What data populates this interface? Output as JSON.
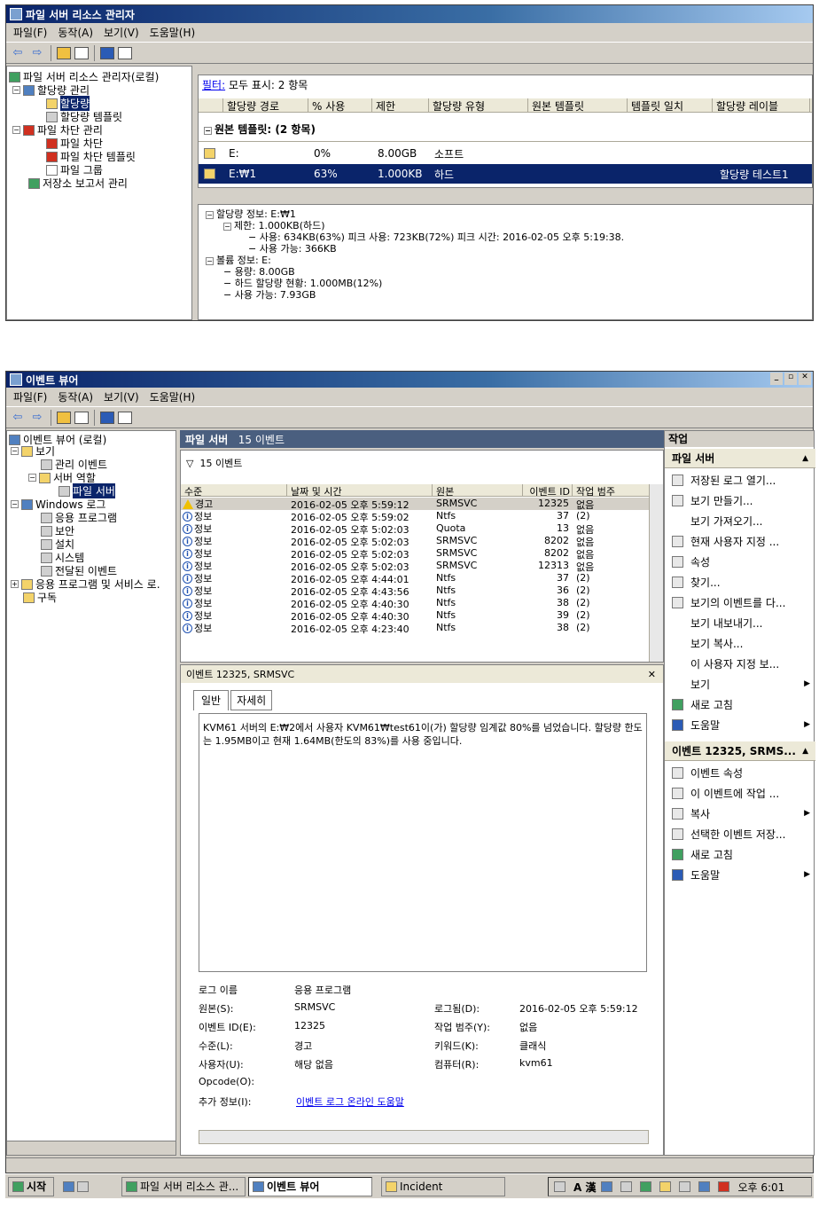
{
  "fsrm": {
    "title": "파일 서버 리소스 관리자",
    "menu": [
      "파일(F)",
      "동작(A)",
      "보기(V)",
      "도움말(H)"
    ],
    "tree": [
      "파일 서버 리소스 관리자(로컬)",
      "할당량 관리",
      "할당량",
      "할당량 템플릿",
      "파일 차단 관리",
      "파일 차단",
      "파일 차단 템플릿",
      "파일 그룹",
      "저장소 보고서 관리"
    ],
    "filter_label": "필터:",
    "filter_text": "모두 표시: 2 항목",
    "columns": [
      "할당량 경로",
      "% 사용",
      "제한",
      "할당량 유형",
      "원본 템플릿",
      "템플릿 일치",
      "할당량 레이블"
    ],
    "group": "원본 템플릿: (2 항목)",
    "rows": [
      {
        "path": "E:",
        "use": "0%",
        "limit": "8.00GB",
        "type": "소프트",
        "label": ""
      },
      {
        "path": "E:₩1",
        "use": "63%",
        "limit": "1.000KB",
        "type": "하드",
        "label": "할당량 테스트1"
      }
    ],
    "details": [
      "할당량 정보: E:₩1",
      "제한: 1.000KB(하드)",
      "사용: 634KB(63%) 피크 사용: 723KB(72%) 피크 시간: 2016-02-05 오후 5:19:38.",
      "사용 가능: 366KB",
      "볼륨 정보: E:",
      "용량: 8.00GB",
      "하드 할당량 현황: 1.000MB(12%)",
      "사용 가능: 7.93GB"
    ]
  },
  "ev": {
    "title": "이벤트 뷰어",
    "menu": [
      "파일(F)",
      "동작(A)",
      "보기(V)",
      "도움말(H)"
    ],
    "tree": [
      "이벤트 뷰어 (로컬)",
      "보기",
      "관리 이벤트",
      "서버 역할",
      "파일 서버",
      "Windows 로그",
      "응용 프로그램",
      "보안",
      "설치",
      "시스템",
      "전달된 이벤트",
      "응용 프로그램 및 서비스 로.",
      "구독"
    ],
    "pane_title": "파일 서버",
    "pane_count": "15 이벤트",
    "filter_text": "15 이벤트",
    "columns": [
      "수준",
      "날짜 및 시간",
      "원본",
      "이벤트 ID",
      "작업 범주"
    ],
    "events": [
      {
        "level": "경고",
        "warn": true,
        "date": "2016-02-05 오후 5:59:12",
        "src": "SRMSVC",
        "id": "12325",
        "cat": "없음"
      },
      {
        "level": "정보",
        "date": "2016-02-05 오후 5:59:02",
        "src": "Ntfs",
        "id": "37",
        "cat": "(2)"
      },
      {
        "level": "정보",
        "date": "2016-02-05 오후 5:02:03",
        "src": "Quota",
        "id": "13",
        "cat": "없음"
      },
      {
        "level": "정보",
        "date": "2016-02-05 오후 5:02:03",
        "src": "SRMSVC",
        "id": "8202",
        "cat": "없음"
      },
      {
        "level": "정보",
        "date": "2016-02-05 오후 5:02:03",
        "src": "SRMSVC",
        "id": "8202",
        "cat": "없음"
      },
      {
        "level": "정보",
        "date": "2016-02-05 오후 5:02:03",
        "src": "SRMSVC",
        "id": "12313",
        "cat": "없음"
      },
      {
        "level": "정보",
        "date": "2016-02-05 오후 4:44:01",
        "src": "Ntfs",
        "id": "37",
        "cat": "(2)"
      },
      {
        "level": "정보",
        "date": "2016-02-05 오후 4:43:56",
        "src": "Ntfs",
        "id": "36",
        "cat": "(2)"
      },
      {
        "level": "정보",
        "date": "2016-02-05 오후 4:40:30",
        "src": "Ntfs",
        "id": "38",
        "cat": "(2)"
      },
      {
        "level": "정보",
        "date": "2016-02-05 오후 4:40:30",
        "src": "Ntfs",
        "id": "39",
        "cat": "(2)"
      },
      {
        "level": "정보",
        "date": "2016-02-05 오후 4:23:40",
        "src": "Ntfs",
        "id": "38",
        "cat": "(2)"
      }
    ],
    "detail_title": "이벤트 12325, SRMSVC",
    "tabs": [
      "일반",
      "자세히"
    ],
    "message": "KVM61 서버의 E:₩2에서 사용자 KVM61₩test61이(가) 할당량 임계값 80%를 넘었습니다. 할당량 한도는 1.95MB이고 현재 1.64MB(한도의 83%)를 사용 중입니다.",
    "fields": {
      "log_name_l": "로그 이름",
      "log_name": "응용 프로그램",
      "source_l": "원본(S):",
      "source": "SRMSVC",
      "logged_l": "로그됨(D):",
      "logged": "2016-02-05 오후 5:59:12",
      "eventid_l": "이벤트 ID(E):",
      "eventid": "12325",
      "task_l": "작업 범주(Y):",
      "task": "없음",
      "level_l": "수준(L):",
      "level": "경고",
      "keywords_l": "키워드(K):",
      "keywords": "클래식",
      "user_l": "사용자(U):",
      "user": "해당 없음",
      "computer_l": "컴퓨터(R):",
      "computer": "kvm61",
      "opcode_l": "Opcode(O):",
      "more_l": "추가 정보(I):",
      "more_link": "이벤트 로그 온라인 도움말"
    },
    "actions_title": "작업",
    "sec1": "파일 서버",
    "actions1": [
      "저장된 로그 열기...",
      "보기 만들기...",
      "보기 가져오기...",
      "현재 사용자 지정 ...",
      "속성",
      "찾기...",
      "보기의 이벤트를 다...",
      "보기 내보내기...",
      "보기 복사...",
      "이 사용자 지정 보...",
      "보기",
      "새로 고침",
      "도움말"
    ],
    "sec2": "이벤트 12325, SRMS...",
    "actions2": [
      "이벤트 속성",
      "이 이벤트에 작업 ...",
      "복사",
      "선택한 이벤트 저장...",
      "새로 고침",
      "도움말"
    ]
  },
  "taskbar": {
    "start": "시작",
    "items": [
      "파일 서버 리소스 관...",
      "이벤트 뷰어",
      "Incident"
    ],
    "ime": "A 漢",
    "clock": "오후 6:01"
  }
}
